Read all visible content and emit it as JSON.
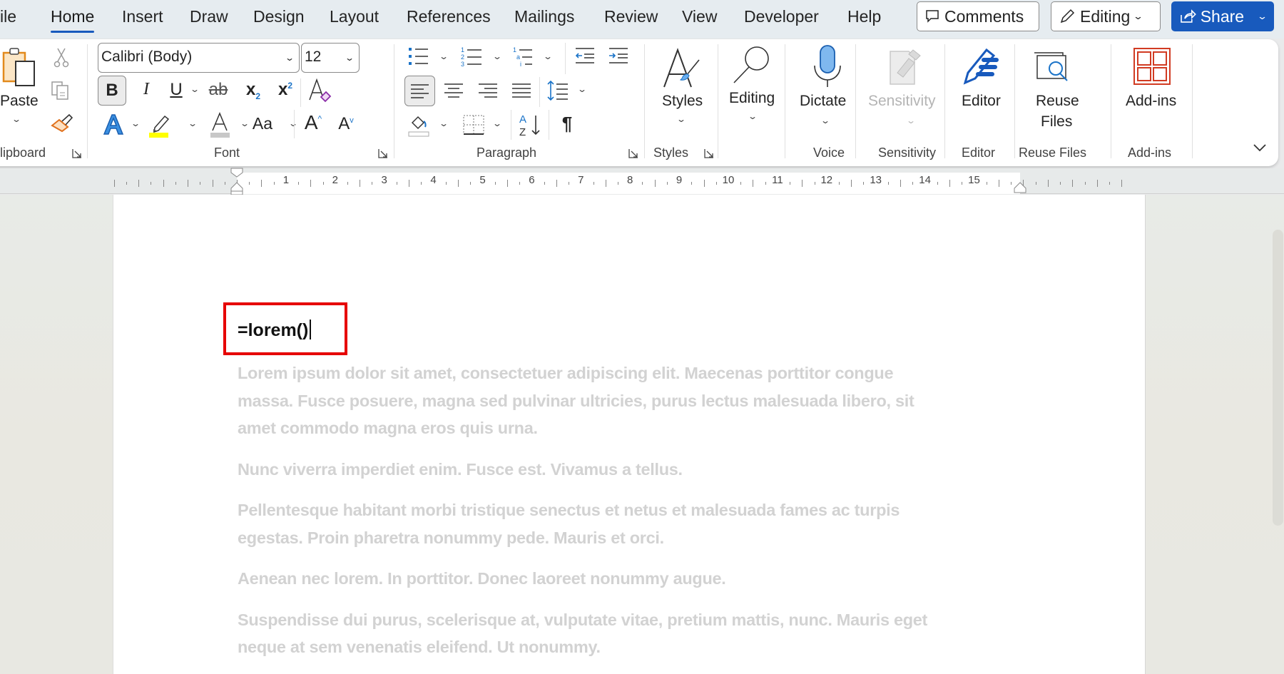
{
  "tabs": [
    {
      "label": "ile",
      "active": false
    },
    {
      "label": "Home",
      "active": true
    },
    {
      "label": "Insert",
      "active": false
    },
    {
      "label": "Draw",
      "active": false
    },
    {
      "label": "Design",
      "active": false
    },
    {
      "label": "Layout",
      "active": false
    },
    {
      "label": "References",
      "active": false
    },
    {
      "label": "Mailings",
      "active": false
    },
    {
      "label": "Review",
      "active": false
    },
    {
      "label": "View",
      "active": false
    },
    {
      "label": "Developer",
      "active": false
    },
    {
      "label": "Help",
      "active": false
    }
  ],
  "top_actions": {
    "comments_label": "Comments",
    "editing_label": "Editing",
    "share_label": "Share",
    "share_color": "#185abd"
  },
  "ribbon": {
    "clipboard": {
      "paste_label": "Paste",
      "group_label": "lipboard"
    },
    "font": {
      "font_name": "Calibri (Body)",
      "font_size": "12",
      "group_label": "Font",
      "bold": "B",
      "italic": "I",
      "underline": "U",
      "strike": "ab",
      "subscript": "x",
      "subscript_mark": "2",
      "superscript": "x",
      "superscript_mark": "2",
      "change_case": "Aa",
      "grow": "A",
      "shrink": "A",
      "highlight_color": "#ffff00",
      "font_color_bar": "#c8c8c8"
    },
    "paragraph": {
      "group_label": "Paragraph",
      "pilcrow": "¶",
      "bold_active": true,
      "align_left_active": true
    },
    "styles": {
      "label": "Styles",
      "group_label": "Styles"
    },
    "editing": {
      "label": "Editing"
    },
    "voice": {
      "label": "Dictate",
      "group_label": "Voice"
    },
    "sensitivity": {
      "label": "Sensitivity",
      "group_label": "Sensitivity",
      "disabled": true
    },
    "editor": {
      "label": "Editor",
      "group_label": "Editor"
    },
    "reuse_files": {
      "label_line1": "Reuse",
      "label_line2": "Files",
      "group_label": "Reuse Files"
    },
    "addins": {
      "label": "Add-ins",
      "group_label": "Add-ins"
    }
  },
  "ruler": {
    "numbers": [
      "1",
      "2",
      "3",
      "4",
      "5",
      "6",
      "7",
      "8",
      "9",
      "10",
      "11",
      "12",
      "13",
      "14",
      "15"
    ]
  },
  "document": {
    "typed_text": "=lorem()",
    "preview_paragraphs": [
      [
        "Lorem ipsum dolor sit amet, consectetuer adipiscing elit. Maecenas porttitor congue",
        "massa. Fusce posuere, magna sed pulvinar ultricies, purus lectus malesuada libero, sit",
        "amet commodo magna eros quis urna."
      ],
      [
        "Nunc viverra imperdiet enim. Fusce est. Vivamus a tellus."
      ],
      [
        "Pellentesque habitant morbi tristique senectus et netus et malesuada fames ac turpis",
        "egestas. Proin pharetra nonummy pede. Mauris et orci."
      ],
      [
        "Aenean nec lorem. In porttitor. Donec laoreet nonummy augue."
      ],
      [
        "Suspendisse dui purus, scelerisque at, vulputate vitae, pretium mattis, nunc. Mauris eget",
        "neque at sem venenatis eleifend. Ut nonummy."
      ]
    ],
    "highlight_color": "#e60000"
  }
}
